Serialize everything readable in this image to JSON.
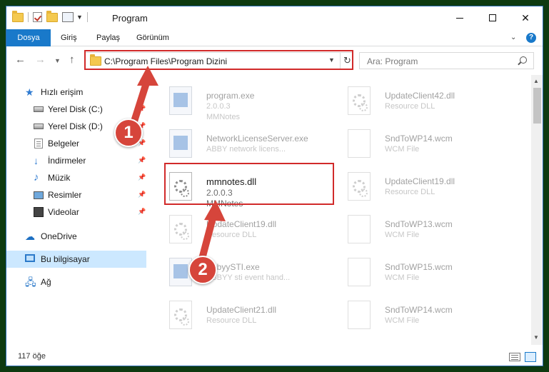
{
  "window": {
    "title": "Program"
  },
  "ribbon": {
    "tabs": [
      "Dosya",
      "Giriş",
      "Paylaş",
      "Görünüm"
    ],
    "help_label": "?"
  },
  "address": {
    "path": "C:\\Program Files\\Program Dizini",
    "refresh_glyph": "↻"
  },
  "search": {
    "placeholder": "Ara: Program"
  },
  "sidebar": {
    "items": [
      {
        "label": "Hızlı erişim",
        "icon": "star-icon"
      },
      {
        "label": "Yerel Disk (C:)",
        "icon": "drive-icon",
        "pinned": true
      },
      {
        "label": "Yerel Disk (D:)",
        "icon": "drive-icon",
        "pinned": true
      },
      {
        "label": "Belgeler",
        "icon": "documents-icon",
        "pinned": true
      },
      {
        "label": "İndirmeler",
        "icon": "download-icon",
        "pinned": true
      },
      {
        "label": "Müzik",
        "icon": "music-icon",
        "pinned": true
      },
      {
        "label": "Resimler",
        "icon": "pictures-icon",
        "pinned": true
      },
      {
        "label": "Videolar",
        "icon": "videos-icon",
        "pinned": true
      },
      {
        "label": "OneDrive",
        "icon": "cloud-icon"
      },
      {
        "label": "Bu bilgisayar",
        "icon": "computer-icon",
        "selected": true
      },
      {
        "label": "Ağ",
        "icon": "network-icon"
      }
    ]
  },
  "files": [
    {
      "name": "program.exe",
      "line1": "2.0.0.3",
      "line2": "MMNotes",
      "icon": "program-icon"
    },
    {
      "name": "UpdateClient42.dll",
      "line1": "Resource DLL",
      "line2": "",
      "icon": "dll-icon"
    },
    {
      "name": "NetworkLicenseServer.exe",
      "line1": "ABBY network licens...",
      "line2": "",
      "icon": "exe-icon"
    },
    {
      "name": "SndToWP14.wcm",
      "line1": "WCM File",
      "line2": "",
      "icon": "page-icon"
    },
    {
      "name": "mmnotes.dll",
      "line1": "2.0.0.3",
      "line2": "MMNotes",
      "icon": "dll-icon"
    },
    {
      "name": "UpdateClient19.dll",
      "line1": "Resource DLL",
      "line2": "",
      "icon": "dll-icon"
    },
    {
      "name": "UpdateClient19.dll",
      "line1": "Resource DLL",
      "line2": "",
      "icon": "dll-icon"
    },
    {
      "name": "SndToWP13.wcm",
      "line1": "WCM File",
      "line2": "",
      "icon": "page-icon"
    },
    {
      "name": "AbbyySTI.exe",
      "line1": "ABBYY sti event hand...",
      "line2": "",
      "icon": "exe-icon"
    },
    {
      "name": "SndToWP15.wcm",
      "line1": "WCM File",
      "line2": "",
      "icon": "page-icon"
    },
    {
      "name": "UpdateClient21.dll",
      "line1": "Resource DLL",
      "line2": "",
      "icon": "dll-icon"
    },
    {
      "name": "SndToWP14.wcm",
      "line1": "WCM File",
      "line2": "",
      "icon": "page-icon"
    }
  ],
  "status": {
    "count": "117 öğe"
  },
  "annotations": {
    "step1": "1",
    "step2": "2",
    "arrow_color": "#d6453b",
    "highlight_color": "#d12a2a"
  }
}
